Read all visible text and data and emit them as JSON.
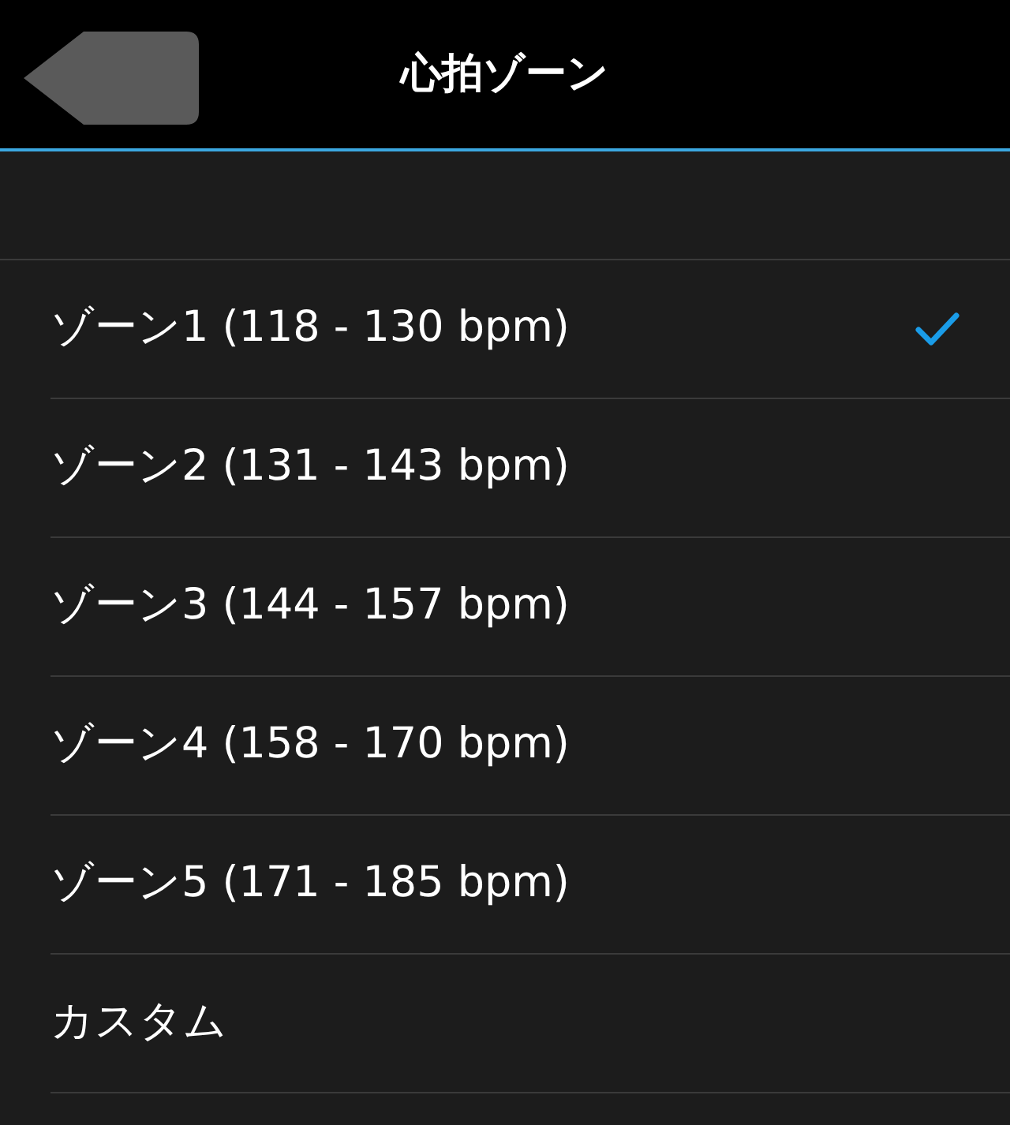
{
  "header": {
    "title": "心拍ゾーン"
  },
  "options": [
    {
      "label": "ゾーン1 (118 - 130 bpm)",
      "selected": true
    },
    {
      "label": "ゾーン2 (131 - 143 bpm)",
      "selected": false
    },
    {
      "label": "ゾーン3 (144 - 157 bpm)",
      "selected": false
    },
    {
      "label": "ゾーン4 (158 - 170 bpm)",
      "selected": false
    },
    {
      "label": "ゾーン5 (171 - 185 bpm)",
      "selected": false
    },
    {
      "label": "カスタム",
      "selected": false
    }
  ]
}
